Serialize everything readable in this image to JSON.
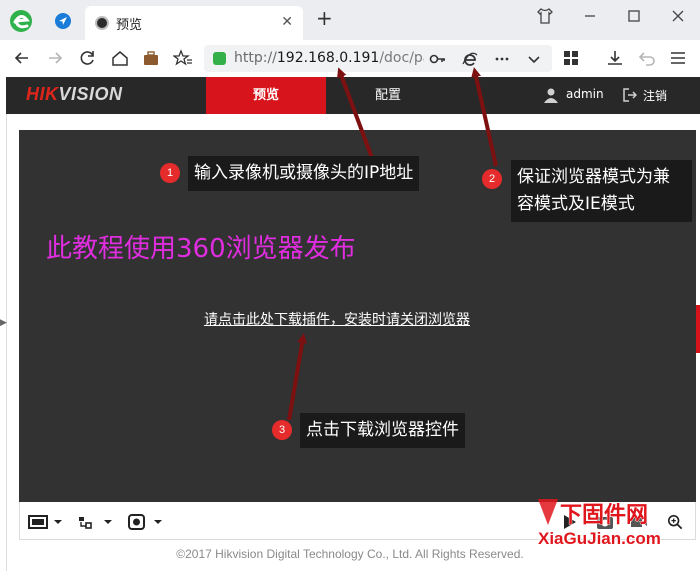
{
  "browser": {
    "tab_title": "预览",
    "tab_close": "✕",
    "new_tab": "+",
    "url_protocol": "http://",
    "url_host": "192.168.0.191",
    "url_path": "/doc/pa"
  },
  "app": {
    "logo_hik": "HIK",
    "logo_vision": "VISION",
    "nav": {
      "preview": "预览",
      "config": "配置"
    },
    "user": "admin",
    "logout": "注销",
    "plugin_link": "请点击此处下载插件，安装时请关闭浏览器",
    "footer": "©2017 Hikvision Digital Technology Co., Ltd. All Rights Reserved."
  },
  "annotations": {
    "a1": {
      "num": "1",
      "text": "输入录像机或摄像头的IP地址"
    },
    "a2": {
      "num": "2",
      "line1": "保证浏览器模式为兼",
      "line2": "容模式及IE模式"
    },
    "a3": {
      "num": "3",
      "text": "点击下载浏览器控件"
    },
    "tutorial_note": "此教程使用360浏览器发布"
  },
  "watermark": {
    "top_text": "下固件网",
    "site": "XiaGuJian.com"
  },
  "colors": {
    "brand_red": "#d7141b",
    "header_bg": "#282828",
    "video_bg": "#323232",
    "note_magenta": "#e02de0",
    "anno_red": "#e52b2b",
    "arrow_red": "#7d1010"
  },
  "icons": {
    "toolbar": [
      "back-icon",
      "forward-icon",
      "reload-icon",
      "home-icon",
      "briefcase-icon",
      "favorites-icon",
      "key-icon",
      "ie-mode-icon",
      "more-icon",
      "dropdown-icon",
      "apps-grid-icon",
      "download-icon",
      "undo-icon",
      "menu-icon"
    ],
    "control_bar": [
      "window-layout-icon",
      "stream-type-icon",
      "snapshot-mode-icon",
      "play-icon",
      "capture-icon",
      "record-icon",
      "zoom-icon"
    ]
  }
}
